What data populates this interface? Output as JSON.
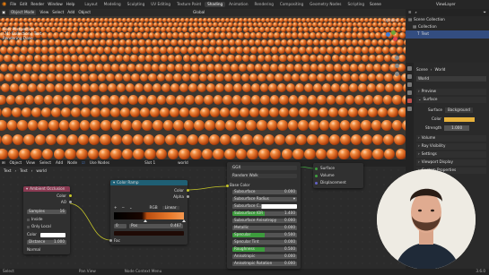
{
  "topbar": {
    "menu": [
      "File",
      "Edit",
      "Render",
      "Window",
      "Help"
    ],
    "tabs": [
      "Layout",
      "Modeling",
      "Sculpting",
      "UV Editing",
      "Texture Paint",
      "Shading",
      "Animation",
      "Rendering",
      "Compositing",
      "Geometry Nodes",
      "Scripting"
    ],
    "active_tab": "Shading",
    "scene_label": "Scene",
    "viewlayer_label": "ViewLayer"
  },
  "viewport": {
    "mode": "Object Mode",
    "menu": [
      "View",
      "Select",
      "Add",
      "Object"
    ],
    "orientation": "Global",
    "options": "Options",
    "info_lines": [
      "User Perspective",
      "(71) Collection | Text",
      "Rendering Done"
    ]
  },
  "node_editor": {
    "editor_type": "Object",
    "menu": [
      "View",
      "Select",
      "Add",
      "Node"
    ],
    "use_nodes": "Use Nodes",
    "slot": "Slot 1",
    "world_name": "world",
    "breadcrumb": [
      "Text",
      "Text",
      "world"
    ],
    "ao_node": {
      "title": "Ambient Occlusion",
      "outputs": [
        "Color",
        "AO"
      ],
      "samples_label": "Samples",
      "samples_value": "16",
      "inside": "Inside",
      "only_local": "Only Local",
      "color": "Color",
      "distance_label": "Distance",
      "distance_value": "1.000",
      "normal": "Normal"
    },
    "ramp_node": {
      "title": "Color Ramp",
      "outputs": [
        "Color",
        "Alpha"
      ],
      "mode": "RGB",
      "interp": "Linear",
      "pos_index": "0",
      "pos_label": "Pos",
      "pos_value": "0.467",
      "input": "Fac"
    },
    "sss_node": {
      "method": "GGX",
      "subsurface_method": "Random Walk",
      "rows": [
        {
          "label": "Base Color",
          "value": ""
        },
        {
          "label": "Subsurface",
          "value": "0.000"
        },
        {
          "label": "Subsurface Radius",
          "value": ""
        },
        {
          "label": "Subsurface C...",
          "value": ""
        },
        {
          "label": "Subsurface IOR",
          "value": "1.400"
        },
        {
          "label": "Subsurface Anisotropy",
          "value": "0.000"
        },
        {
          "label": "Metallic",
          "value": "0.000"
        },
        {
          "label": "Specular",
          "value": "0.500"
        },
        {
          "label": "Specular Tint",
          "value": "0.000"
        },
        {
          "label": "Roughness",
          "value": "0.500"
        },
        {
          "label": "Anisotropic",
          "value": "0.000"
        },
        {
          "label": "Anisotropic Rotation",
          "value": "0.000"
        }
      ]
    },
    "output_node": {
      "sockets": [
        "Surface",
        "Volume",
        "Displacement"
      ]
    }
  },
  "outliner": {
    "items": [
      "Scene Collection",
      "Collection",
      "Text"
    ]
  },
  "properties": {
    "scene": "Scene",
    "world": "World",
    "world_name": "World",
    "sections": [
      "Preview",
      "Surface",
      "Volume",
      "Ray Visibility",
      "Settings",
      "Viewport Display",
      "Custom Properties"
    ],
    "surface_label": "Surface",
    "surface_value": "Background",
    "color_label": "Color",
    "strength_label": "Strength",
    "strength_value": "1.000"
  },
  "statusbar": {
    "items": [
      "Select",
      "Pan View",
      "Node Context Menu"
    ],
    "version": "3.6.0"
  },
  "colors": {
    "accent": "#4772b3",
    "ao_header": "#8a3a52",
    "ramp_header": "#1f5f74",
    "green_field": "#3d9c3d",
    "sphere": "#e0773a"
  }
}
